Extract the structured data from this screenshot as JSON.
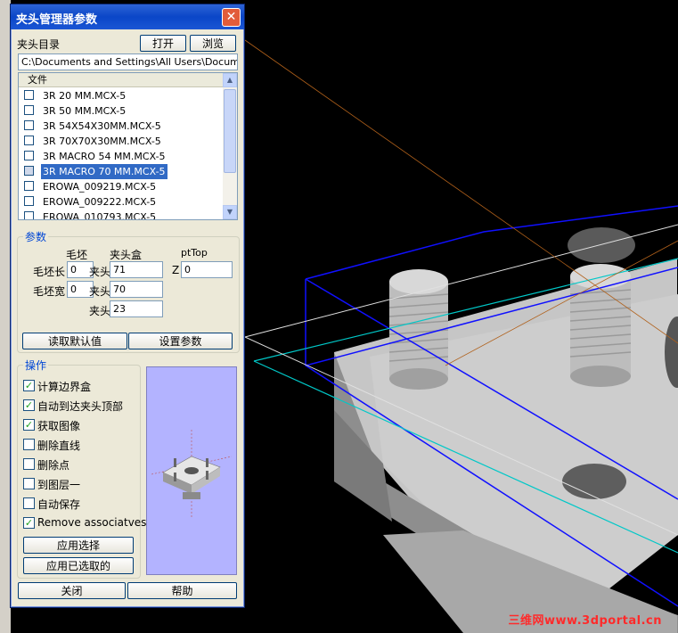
{
  "window": {
    "title": "夹头管理器参数",
    "close_symbol": "✕"
  },
  "directory": {
    "label": "夹头目录",
    "open_button": "打开",
    "browse_button": "浏览",
    "path": "C:\\Documents and Settings\\All Users\\Documents\\"
  },
  "file_list": {
    "header": "文件",
    "items": [
      {
        "name": "3R 20 MM.MCX-5",
        "selected": false
      },
      {
        "name": "3R 50 MM.MCX-5",
        "selected": false
      },
      {
        "name": "3R 54X54X30MM.MCX-5",
        "selected": false
      },
      {
        "name": "3R 70X70X30MM.MCX-5",
        "selected": false
      },
      {
        "name": "3R MACRO 54 MM.MCX-5",
        "selected": false
      },
      {
        "name": "3R MACRO 70 MM.MCX-5",
        "selected": true
      },
      {
        "name": "EROWA_009219.MCX-5",
        "selected": false
      },
      {
        "name": "EROWA_009222.MCX-5",
        "selected": false
      },
      {
        "name": "EROWA_010793.MCX-5",
        "selected": false
      }
    ]
  },
  "params": {
    "legend": "参数",
    "col_stock": "毛坯",
    "col_chuck": "夹头盒",
    "col_pttop": "ptTop",
    "stock_length_label": "毛坯长",
    "stock_width_label": "毛坯宽",
    "stock_length_value": "0",
    "stock_width_value": "0",
    "chuck_label_1": "夹头",
    "chuck_label_2": "夹头",
    "chuck_label_3": "夹头",
    "chuck_value_1": "71",
    "chuck_value_2": "70",
    "chuck_value_3": "23",
    "z_label": "Z",
    "z_value": "0",
    "read_default_button": "读取默认值",
    "set_params_button": "设置参数"
  },
  "operations": {
    "legend": "操作",
    "checkboxes": [
      {
        "label": "计算边界盒",
        "checked": true
      },
      {
        "label": "自动到达夹头顶部",
        "checked": true
      },
      {
        "label": "获取图像",
        "checked": true
      },
      {
        "label": "删除直线",
        "checked": false
      },
      {
        "label": "删除点",
        "checked": false
      },
      {
        "label": "到图层一",
        "checked": false
      },
      {
        "label": "自动保存",
        "checked": false
      },
      {
        "label": "Remove associatves",
        "checked": true
      }
    ],
    "apply_selection_button": "应用选择",
    "apply_selected_button": "应用已选取的"
  },
  "footer": {
    "close_button": "关闭",
    "help_button": "帮助"
  },
  "watermark": "三维网www.3dportal.cn",
  "colors": {
    "accent": "#0a246a",
    "selection": "#316ac5",
    "preview_bg": "#b3b3ff",
    "watermark": "#ff2a2a"
  }
}
